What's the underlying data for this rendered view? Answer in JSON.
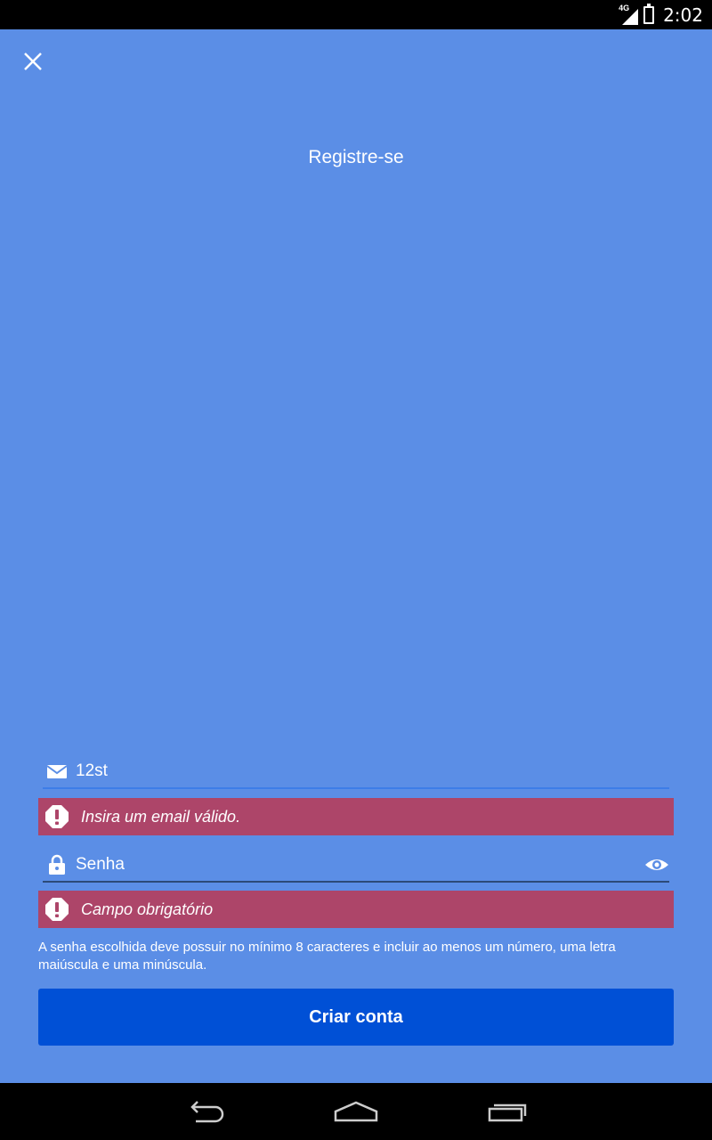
{
  "status_bar": {
    "network": "4G",
    "time": "2:02"
  },
  "header": {
    "title": "Registre-se"
  },
  "form": {
    "email": {
      "value": "12st",
      "error": "Insira um email válido."
    },
    "password": {
      "placeholder": "Senha",
      "error": "Campo obrigatório"
    },
    "hint": "A senha escolhida deve possuir no mínimo 8 caracteres e incluir ao menos um número, uma letra maiúscula e uma minúscula.",
    "submit_label": "Criar conta"
  },
  "colors": {
    "background": "#5b8ee6",
    "error_background": "#ad4569",
    "button": "#0050d6"
  }
}
